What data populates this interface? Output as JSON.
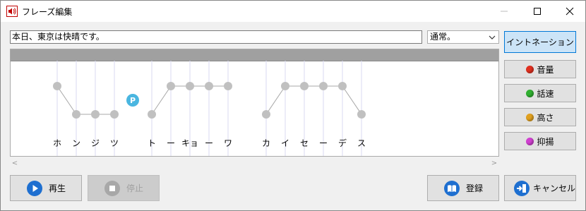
{
  "window": {
    "title": "フレーズ編集",
    "min_label": "—",
    "max_label": "☐",
    "close_label": "✕"
  },
  "phrase": {
    "text": "本日、東京は快晴です。"
  },
  "style_select": {
    "value": "通常。"
  },
  "editor": {
    "kana": [
      "ホ",
      "ン",
      "ジ",
      "ツ",
      "ト",
      "ー",
      "キョ",
      "ー",
      "ワ",
      "カ",
      "イ",
      "セ",
      "ー",
      "デ",
      "ス"
    ],
    "pitch_levels": [
      "H",
      "L",
      "L",
      "L",
      "L",
      "H",
      "H",
      "H",
      "H",
      "L",
      "H",
      "H",
      "H",
      "H",
      "L"
    ],
    "pause_marker": "P"
  },
  "side_buttons": [
    {
      "label": "イントネーション",
      "dot_color": ""
    },
    {
      "label": "音量",
      "dot_color": "#e03020"
    },
    {
      "label": "話速",
      "dot_color": "#30b030"
    },
    {
      "label": "高さ",
      "dot_color": "#e0a020"
    },
    {
      "label": "抑揚",
      "dot_color": "#d040d0"
    }
  ],
  "bottom_buttons": {
    "play": "再生",
    "stop": "停止",
    "register": "登録",
    "cancel": "キャンセル"
  },
  "colors": {
    "accent": "#0078d7",
    "play_icon": "#1e6fd0",
    "node": "#c0c0c0",
    "pause_badge": "#4ab6e0"
  }
}
